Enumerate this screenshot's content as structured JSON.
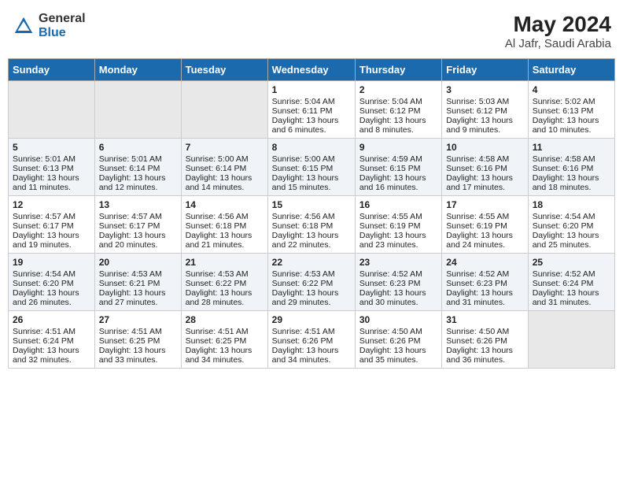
{
  "header": {
    "logo_general": "General",
    "logo_blue": "Blue",
    "month_year": "May 2024",
    "location": "Al Jafr, Saudi Arabia"
  },
  "days_of_week": [
    "Sunday",
    "Monday",
    "Tuesday",
    "Wednesday",
    "Thursday",
    "Friday",
    "Saturday"
  ],
  "weeks": [
    [
      {
        "day": "",
        "info": ""
      },
      {
        "day": "",
        "info": ""
      },
      {
        "day": "",
        "info": ""
      },
      {
        "day": "1",
        "info": "Sunrise: 5:04 AM\nSunset: 6:11 PM\nDaylight: 13 hours and 6 minutes."
      },
      {
        "day": "2",
        "info": "Sunrise: 5:04 AM\nSunset: 6:12 PM\nDaylight: 13 hours and 8 minutes."
      },
      {
        "day": "3",
        "info": "Sunrise: 5:03 AM\nSunset: 6:12 PM\nDaylight: 13 hours and 9 minutes."
      },
      {
        "day": "4",
        "info": "Sunrise: 5:02 AM\nSunset: 6:13 PM\nDaylight: 13 hours and 10 minutes."
      }
    ],
    [
      {
        "day": "5",
        "info": "Sunrise: 5:01 AM\nSunset: 6:13 PM\nDaylight: 13 hours and 11 minutes."
      },
      {
        "day": "6",
        "info": "Sunrise: 5:01 AM\nSunset: 6:14 PM\nDaylight: 13 hours and 12 minutes."
      },
      {
        "day": "7",
        "info": "Sunrise: 5:00 AM\nSunset: 6:14 PM\nDaylight: 13 hours and 14 minutes."
      },
      {
        "day": "8",
        "info": "Sunrise: 5:00 AM\nSunset: 6:15 PM\nDaylight: 13 hours and 15 minutes."
      },
      {
        "day": "9",
        "info": "Sunrise: 4:59 AM\nSunset: 6:15 PM\nDaylight: 13 hours and 16 minutes."
      },
      {
        "day": "10",
        "info": "Sunrise: 4:58 AM\nSunset: 6:16 PM\nDaylight: 13 hours and 17 minutes."
      },
      {
        "day": "11",
        "info": "Sunrise: 4:58 AM\nSunset: 6:16 PM\nDaylight: 13 hours and 18 minutes."
      }
    ],
    [
      {
        "day": "12",
        "info": "Sunrise: 4:57 AM\nSunset: 6:17 PM\nDaylight: 13 hours and 19 minutes."
      },
      {
        "day": "13",
        "info": "Sunrise: 4:57 AM\nSunset: 6:17 PM\nDaylight: 13 hours and 20 minutes."
      },
      {
        "day": "14",
        "info": "Sunrise: 4:56 AM\nSunset: 6:18 PM\nDaylight: 13 hours and 21 minutes."
      },
      {
        "day": "15",
        "info": "Sunrise: 4:56 AM\nSunset: 6:18 PM\nDaylight: 13 hours and 22 minutes."
      },
      {
        "day": "16",
        "info": "Sunrise: 4:55 AM\nSunset: 6:19 PM\nDaylight: 13 hours and 23 minutes."
      },
      {
        "day": "17",
        "info": "Sunrise: 4:55 AM\nSunset: 6:19 PM\nDaylight: 13 hours and 24 minutes."
      },
      {
        "day": "18",
        "info": "Sunrise: 4:54 AM\nSunset: 6:20 PM\nDaylight: 13 hours and 25 minutes."
      }
    ],
    [
      {
        "day": "19",
        "info": "Sunrise: 4:54 AM\nSunset: 6:20 PM\nDaylight: 13 hours and 26 minutes."
      },
      {
        "day": "20",
        "info": "Sunrise: 4:53 AM\nSunset: 6:21 PM\nDaylight: 13 hours and 27 minutes."
      },
      {
        "day": "21",
        "info": "Sunrise: 4:53 AM\nSunset: 6:22 PM\nDaylight: 13 hours and 28 minutes."
      },
      {
        "day": "22",
        "info": "Sunrise: 4:53 AM\nSunset: 6:22 PM\nDaylight: 13 hours and 29 minutes."
      },
      {
        "day": "23",
        "info": "Sunrise: 4:52 AM\nSunset: 6:23 PM\nDaylight: 13 hours and 30 minutes."
      },
      {
        "day": "24",
        "info": "Sunrise: 4:52 AM\nSunset: 6:23 PM\nDaylight: 13 hours and 31 minutes."
      },
      {
        "day": "25",
        "info": "Sunrise: 4:52 AM\nSunset: 6:24 PM\nDaylight: 13 hours and 31 minutes."
      }
    ],
    [
      {
        "day": "26",
        "info": "Sunrise: 4:51 AM\nSunset: 6:24 PM\nDaylight: 13 hours and 32 minutes."
      },
      {
        "day": "27",
        "info": "Sunrise: 4:51 AM\nSunset: 6:25 PM\nDaylight: 13 hours and 33 minutes."
      },
      {
        "day": "28",
        "info": "Sunrise: 4:51 AM\nSunset: 6:25 PM\nDaylight: 13 hours and 34 minutes."
      },
      {
        "day": "29",
        "info": "Sunrise: 4:51 AM\nSunset: 6:26 PM\nDaylight: 13 hours and 34 minutes."
      },
      {
        "day": "30",
        "info": "Sunrise: 4:50 AM\nSunset: 6:26 PM\nDaylight: 13 hours and 35 minutes."
      },
      {
        "day": "31",
        "info": "Sunrise: 4:50 AM\nSunset: 6:26 PM\nDaylight: 13 hours and 36 minutes."
      },
      {
        "day": "",
        "info": ""
      }
    ]
  ]
}
